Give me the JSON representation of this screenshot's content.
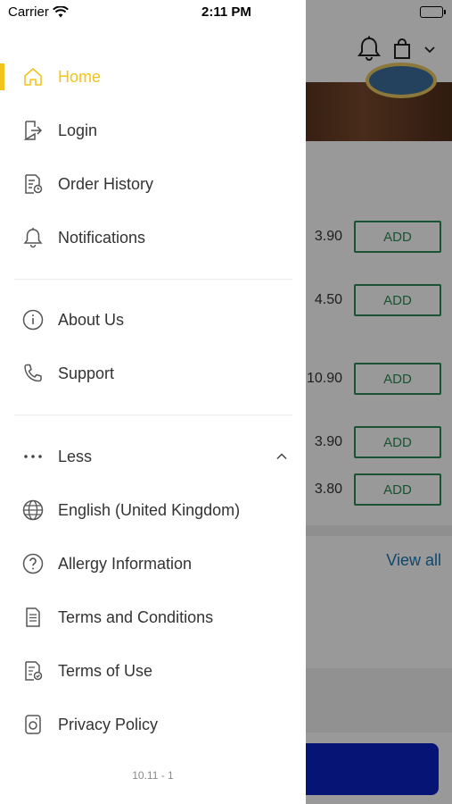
{
  "status_bar": {
    "carrier": "Carrier",
    "time": "2:11 PM"
  },
  "menu": {
    "primary": [
      {
        "label": "Home",
        "icon": "home-icon",
        "active": true
      },
      {
        "label": "Login",
        "icon": "login-icon"
      },
      {
        "label": "Order History",
        "icon": "order-history-icon"
      },
      {
        "label": "Notifications",
        "icon": "bell-icon"
      }
    ],
    "secondary": [
      {
        "label": "About Us",
        "icon": "info-icon"
      },
      {
        "label": "Support",
        "icon": "phone-icon"
      }
    ],
    "toggle": {
      "label": "Less",
      "icon": "more-dots-icon"
    },
    "extra": [
      {
        "label": "English (United Kingdom)",
        "icon": "globe-icon"
      },
      {
        "label": "Allergy Information",
        "icon": "question-icon"
      },
      {
        "label": "Terms and Conditions",
        "icon": "document-icon"
      },
      {
        "label": "Terms of Use",
        "icon": "document-check-icon"
      },
      {
        "label": "Privacy Policy",
        "icon": "privacy-icon"
      }
    ],
    "version": "10.11 - 1"
  },
  "background": {
    "items": [
      {
        "price": "3.90",
        "button": "ADD"
      },
      {
        "price": "4.50",
        "button": "ADD"
      },
      {
        "price": "10.90",
        "button": "ADD"
      },
      {
        "price": "3.90",
        "button": "ADD"
      },
      {
        "price": "3.80",
        "button": "ADD"
      }
    ],
    "view_all": "View all"
  },
  "colors": {
    "accent": "#f2c31b",
    "text": "#333333",
    "add_green": "#2c8a52",
    "link_blue": "#1a78b4",
    "cta_blue": "#0b22c4"
  }
}
